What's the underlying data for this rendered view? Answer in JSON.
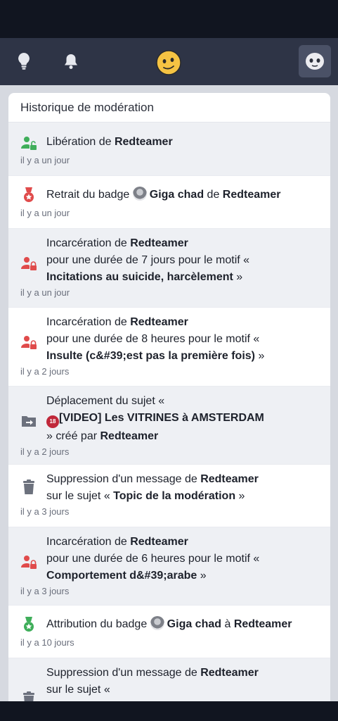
{
  "header": {
    "icons": [
      "lightbulb-icon",
      "bell-icon",
      "site-logo-smiley",
      "user-avatar"
    ]
  },
  "panel": {
    "title": "Historique de modération"
  },
  "entries": [
    {
      "icon": "user-unlock-icon",
      "p1": "Libération de ",
      "b1": "Redteamer",
      "time": "il y a un jour"
    },
    {
      "icon": "badge-remove-icon",
      "p1": "Retrait du badge ",
      "b1": "Giga chad",
      "p2": " de ",
      "b2": "Redteamer",
      "time": "il y a un jour"
    },
    {
      "icon": "user-lock-icon",
      "p1": "Incarcération de ",
      "b1": "Redteamer",
      "p2": "pour une durée de 7 jours pour le motif « ",
      "b2": "Incitations au suicide, harcèlement",
      "p3": " »",
      "time": "il y a un jour"
    },
    {
      "icon": "user-lock-icon",
      "p1": "Incarcération de ",
      "b1": "Redteamer",
      "p2": "pour une durée de 8 heures pour le motif « ",
      "b2": "Insulte (c&#39;est pas la première fois)",
      "p3": " »",
      "time": "il y a 2 jours"
    },
    {
      "icon": "folder-move-icon",
      "p1": "Déplacement du sujet « ",
      "adult": "18",
      "b1": "[VIDEO] Les VITRINES à AMSTERDAM",
      "p2": "» créé par ",
      "b2": "Redteamer",
      "time": "il y a 2 jours"
    },
    {
      "icon": "trash-icon",
      "p1": "Suppression d'un message de ",
      "b1": "Redteamer",
      "p2": "sur le sujet « ",
      "b2": "Topic de la modération",
      "p3": " »",
      "time": "il y a 3 jours"
    },
    {
      "icon": "user-lock-icon",
      "p1": "Incarcération de ",
      "b1": "Redteamer",
      "p2": "pour une durée de 6 heures pour le motif « ",
      "b2": "Comportement d&#39;arabe",
      "p3": " »",
      "time": "il y a 3 jours"
    },
    {
      "icon": "badge-award-icon",
      "p1": "Attribution du badge ",
      "b1": "Giga chad",
      "p2": " à ",
      "b2": "Redteamer",
      "time": "il y a 10 jours"
    },
    {
      "icon": "trash-icon",
      "p1": "Suppression d'un message de ",
      "b1": "Redteamer",
      "p2": "sur le sujet «",
      "time": ""
    }
  ],
  "colors": {
    "topbar": "#2e3446",
    "lock_red": "#e04b4b",
    "unlock_green": "#3fae5a",
    "folder_gray": "#6c717d"
  }
}
